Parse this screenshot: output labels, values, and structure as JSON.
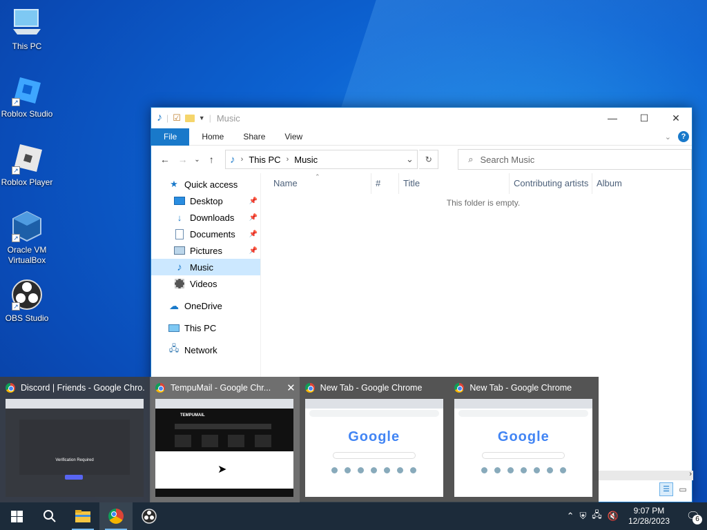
{
  "desktop": {
    "icons": [
      {
        "label": "This PC",
        "icon": "this-pc-icon"
      },
      {
        "label": "Roblox Studio",
        "icon": "roblox-studio-icon"
      },
      {
        "label": "Roblox Player",
        "icon": "roblox-player-icon"
      },
      {
        "label": "Oracle VM VirtualBox",
        "icon": "virtualbox-icon"
      },
      {
        "label": "OBS Studio",
        "icon": "obs-icon"
      }
    ]
  },
  "explorer": {
    "title": "Music",
    "tabs": {
      "file": "File",
      "home": "Home",
      "share": "Share",
      "view": "View"
    },
    "breadcrumb": [
      "This PC",
      "Music"
    ],
    "search_placeholder": "Search Music",
    "nav": {
      "quick_access": "Quick access",
      "desktop": "Desktop",
      "downloads": "Downloads",
      "documents": "Documents",
      "pictures": "Pictures",
      "music": "Music",
      "videos": "Videos",
      "onedrive": "OneDrive",
      "this_pc": "This PC",
      "network": "Network"
    },
    "columns": {
      "name": "Name",
      "number": "#",
      "title": "Title",
      "artists": "Contributing artists",
      "album": "Album"
    },
    "empty_message": "This folder is empty."
  },
  "thumbnails": [
    {
      "title": "Discord | Friends - Google Chro..."
    },
    {
      "title": "TempuMail - Google Chr..."
    },
    {
      "title": "New Tab - Google Chrome"
    },
    {
      "title": "New Tab - Google Chrome"
    }
  ],
  "thumb_text": {
    "verification": "Verification Required",
    "tempumail": "TEMPUMAIL",
    "google": "Google"
  },
  "taskbar": {
    "time": "9:07 PM",
    "date": "12/28/2023",
    "notification_count": "6"
  },
  "colors": {
    "accent": "#1979ca",
    "selected_nav": "#cce8ff",
    "taskbar": "#1c2b3a"
  }
}
